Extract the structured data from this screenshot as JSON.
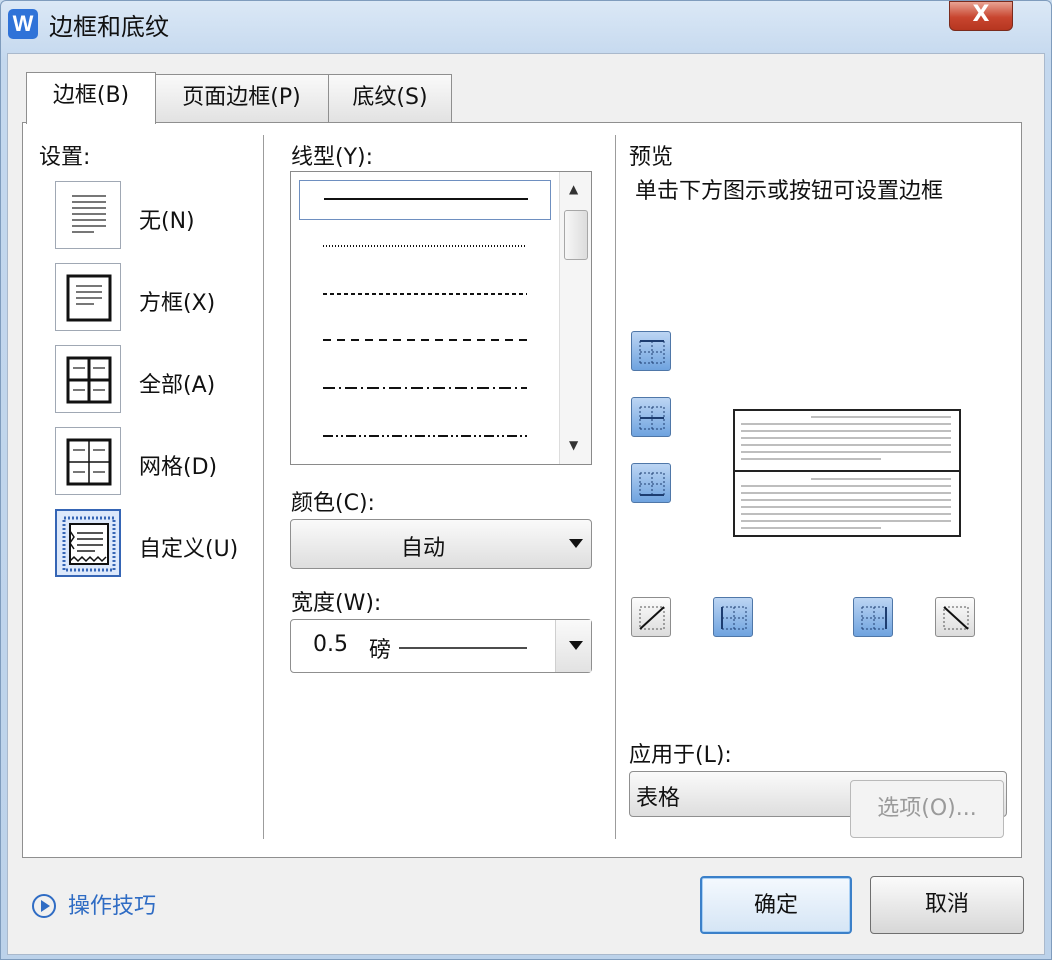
{
  "window": {
    "title": "边框和底纹",
    "app_icon": "W",
    "close_label": "X"
  },
  "tabs": [
    {
      "label": "边框(B)"
    },
    {
      "label": "页面边框(P)"
    },
    {
      "label": "底纹(S)"
    }
  ],
  "settings": {
    "label": "设置:",
    "items": [
      {
        "label": "无(N)",
        "icon": "none-setting-icon"
      },
      {
        "label": "方框(X)",
        "icon": "box-setting-icon"
      },
      {
        "label": "全部(A)",
        "icon": "all-setting-icon"
      },
      {
        "label": "网格(D)",
        "icon": "grid-setting-icon"
      },
      {
        "label": "自定义(U)",
        "icon": "custom-setting-icon",
        "selected": true
      }
    ]
  },
  "line_style": {
    "label": "线型(Y):",
    "options": [
      "solid",
      "dotted",
      "dashed",
      "long-dash",
      "dash-dot",
      "dash-dot-dot"
    ],
    "selected_index": 0
  },
  "color": {
    "label": "颜色(C):",
    "value": "自动"
  },
  "width": {
    "label": "宽度(W):",
    "value": "0.5",
    "unit": "磅"
  },
  "preview": {
    "label": "预览",
    "hint": "单击下方图示或按钮可设置边框"
  },
  "apply_to": {
    "label": "应用于(L):",
    "value": "表格"
  },
  "options_button": "选项(O)...",
  "tips": "操作技巧",
  "ok": "确定",
  "cancel": "取消",
  "colors": {
    "accent": "#2f6cc4",
    "selected_bg": "#dce8fb",
    "toggle_on": "#6fa3df"
  }
}
